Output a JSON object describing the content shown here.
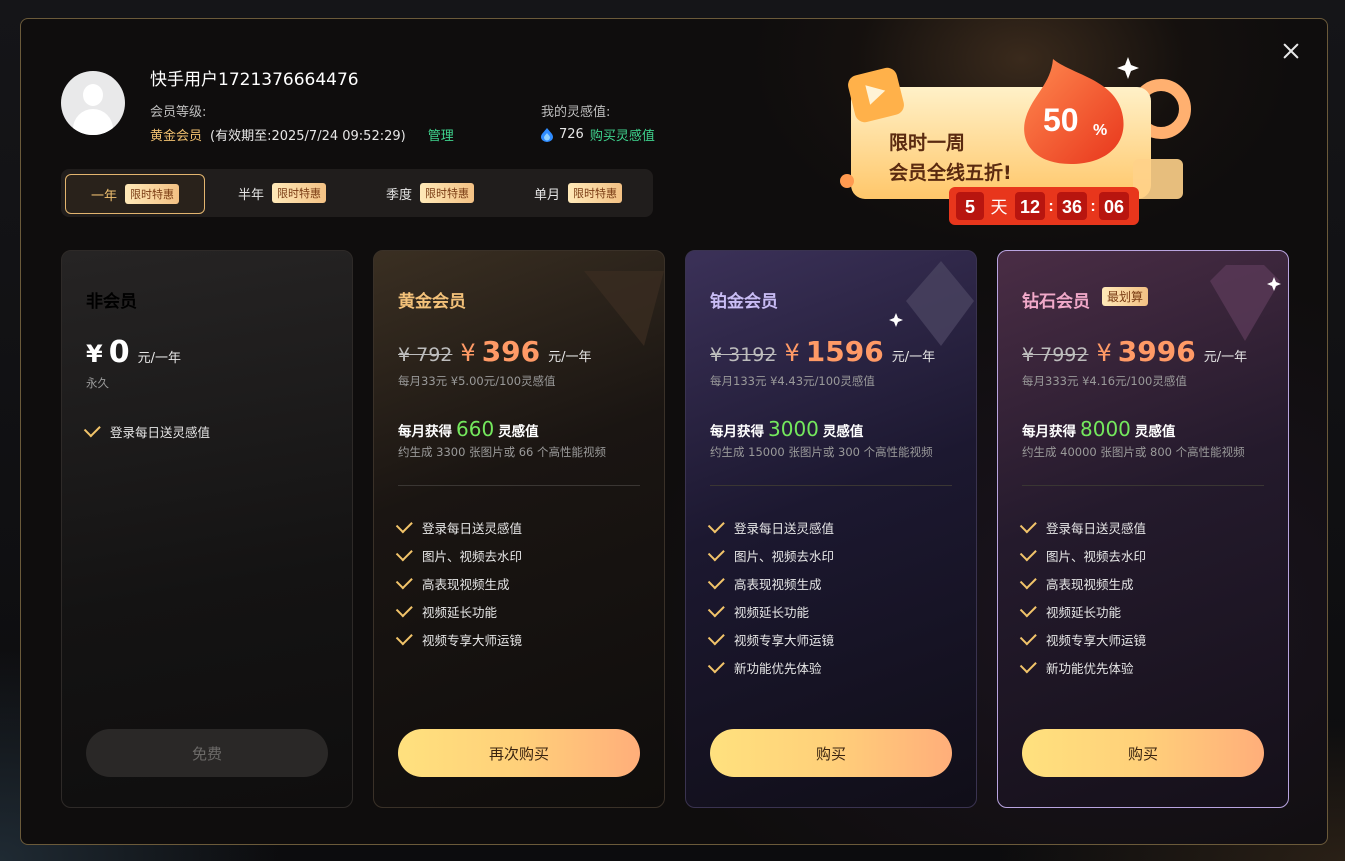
{
  "user": {
    "name": "快手用户1721376664476",
    "level_label": "会员等级:",
    "level_value": "黄金会员",
    "expiry": "(有效期至:2025/7/24 09:52:29)",
    "manage": "管理",
    "inspiration_label": "我的灵感值:",
    "inspiration_value": "726",
    "buy_inspiration": "购买灵感值"
  },
  "tabs": [
    {
      "label": "一年",
      "badge": "限时特惠",
      "active": true
    },
    {
      "label": "半年",
      "badge": "限时特惠",
      "active": false
    },
    {
      "label": "季度",
      "badge": "限时特惠",
      "active": false
    },
    {
      "label": "单月",
      "badge": "限时特惠",
      "active": false
    }
  ],
  "promo": {
    "line1": "限时一周",
    "line2": "会员全线五折!",
    "discount": "50",
    "percent": "%",
    "days": "5",
    "days_unit": "天",
    "hours": "12",
    "minutes": "36",
    "seconds": "06"
  },
  "plans": [
    {
      "title": "非会员",
      "yen": "¥",
      "price": "0",
      "unit": "元/一年",
      "duration": "永久",
      "features": [
        "登录每日送灵感值"
      ],
      "button": "免费",
      "title_color": "#ffffff"
    },
    {
      "title": "黄金会员",
      "old": "¥ 792",
      "yen": "¥",
      "price": "396",
      "unit": "元/一年",
      "sub": "每月33元 ¥5.00元/100灵感值",
      "earn_prefix": "每月获得",
      "earn_num": "660",
      "earn_suffix": "灵感值",
      "gen": "约生成 3300 张图片或 66 个高性能视频",
      "features": [
        "登录每日送灵感值",
        "图片、视频去水印",
        "高表现视频生成",
        "视频延长功能",
        "视频专享大师运镜"
      ],
      "button": "再次购买",
      "title_color": "#f4c27a"
    },
    {
      "title": "铂金会员",
      "old": "¥ 3192",
      "yen": "¥",
      "price": "1596",
      "unit": "元/一年",
      "sub": "每月133元 ¥4.43元/100灵感值",
      "earn_prefix": "每月获得",
      "earn_num": "3000",
      "earn_suffix": "灵感值",
      "gen": "约生成 15000 张图片或 300 个高性能视频",
      "features": [
        "登录每日送灵感值",
        "图片、视频去水印",
        "高表现视频生成",
        "视频延长功能",
        "视频专享大师运镜",
        "新功能优先体验"
      ],
      "button": "购买",
      "title_color": "#c9bdf5"
    },
    {
      "title": "钻石会员",
      "badge": "最划算",
      "old": "¥ 7992",
      "yen": "¥",
      "price": "3996",
      "unit": "元/一年",
      "sub": "每月333元 ¥4.16元/100灵感值",
      "earn_prefix": "每月获得",
      "earn_num": "8000",
      "earn_suffix": "灵感值",
      "gen": "约生成 40000 张图片或 800 个高性能视频",
      "features": [
        "登录每日送灵感值",
        "图片、视频去水印",
        "高表现视频生成",
        "视频延长功能",
        "视频专享大师运镜",
        "新功能优先体验"
      ],
      "button": "购买",
      "title_color": "#f1a9c9"
    }
  ]
}
